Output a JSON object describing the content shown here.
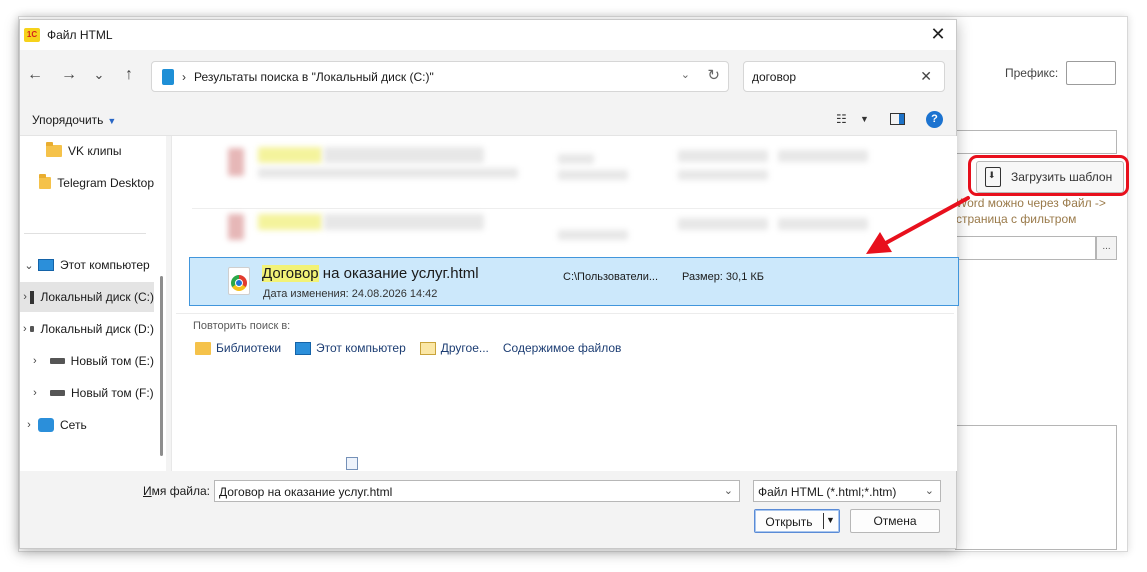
{
  "background_form": {
    "prefix_label": "Префикс:",
    "template_button": "Загрузить шаблон",
    "hint": "Word можно через Файл -> страница с фильтром",
    "browse_label": "...",
    "highlight_color": "#e8101d"
  },
  "dialog": {
    "app_icon_text": "1C",
    "title": "Файл HTML",
    "close": "✕",
    "nav": {
      "back": "←",
      "forward": "→",
      "recent": "⌄",
      "up": "↑"
    },
    "address": {
      "separator": "›",
      "text": "Результаты поиска в \"Локальный диск (C:)\"",
      "dropdown": "⌄",
      "refresh": "↻"
    },
    "search": {
      "value": "договор",
      "clear": "✕"
    },
    "toolbar": {
      "organize": "Упорядочить",
      "organize_caret": "▼",
      "view_icon": "list-view-icon",
      "view_caret": "▼",
      "help": "?"
    },
    "tree": [
      {
        "label": "VK клипы",
        "icon": "folder-icon"
      },
      {
        "label": "Telegram Desktop",
        "icon": "folder-icon"
      },
      {
        "label": "Этот компьютер",
        "icon": "computer-icon",
        "chevron": "⌄"
      },
      {
        "label": "Локальный диск (C:)",
        "icon": "windows-drive-icon",
        "chevron": "›"
      },
      {
        "label": "Локальный диск (D:)",
        "icon": "drive-icon",
        "chevron": "›"
      },
      {
        "label": "Новый том (E:)",
        "icon": "drive-icon",
        "chevron": "›"
      },
      {
        "label": "Новый том (F:)",
        "icon": "drive-icon",
        "chevron": "›"
      },
      {
        "label": "Сеть",
        "icon": "network-icon",
        "chevron": "›"
      }
    ],
    "result": {
      "name_highlight": "Договор",
      "name_rest": " на оказание услуг.html",
      "modified": "Дата изменения: 24.08.2026 14:42",
      "path": "C:\\Пользователи...",
      "size": "Размер: 30,1 КБ"
    },
    "repeat_search": {
      "label": "Повторить поиск в:",
      "links": [
        "Библиотеки",
        "Этот компьютер",
        "Другое...",
        "Содержимое файлов"
      ]
    },
    "filename": {
      "label_underlined": "И",
      "label_rest": "мя файла:",
      "value": "Договор на оказание услуг.html",
      "dropdown": "⌄"
    },
    "filetype": {
      "value": "Файл HTML (*.html;*.htm)",
      "dropdown": "⌄"
    },
    "buttons": {
      "open": "Открыть",
      "open_caret": "▼",
      "cancel": "Отмена"
    }
  }
}
